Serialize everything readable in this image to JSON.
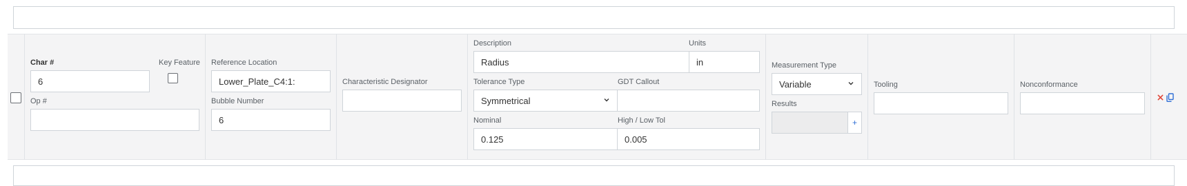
{
  "row": {
    "char_label": "Char #",
    "char_value": "6",
    "key_feature_label": "Key Feature",
    "op_label": "Op #",
    "op_value": "",
    "ref_location_label": "Reference Location",
    "ref_location_value": "Lower_Plate_C4:1:",
    "bubble_label": "Bubble Number",
    "bubble_value": "6",
    "char_designator_label": "Characteristic Designator",
    "char_designator_value": "",
    "description_label": "Description",
    "description_value": "Radius",
    "units_label": "Units",
    "units_value": "in",
    "tolerance_type_label": "Tolerance Type",
    "tolerance_type_value": "Symmetrical",
    "gdt_label": "GDT Callout",
    "gdt_value": "",
    "nominal_label": "Nominal",
    "nominal_value": "0.125",
    "highlow_label": "High / Low Tol",
    "highlow_value": "0.005",
    "measurement_type_label": "Measurement Type",
    "measurement_type_value": "Variable",
    "results_label": "Results",
    "results_add": "+",
    "tooling_label": "Tooling",
    "tooling_value": "",
    "nonconformance_label": "Nonconformance",
    "nonconformance_value": ""
  },
  "icons": {
    "delete": "close-icon",
    "copy": "copy-icon"
  },
  "colors": {
    "delete": "#e0473a",
    "copy": "#2f6fd6"
  }
}
